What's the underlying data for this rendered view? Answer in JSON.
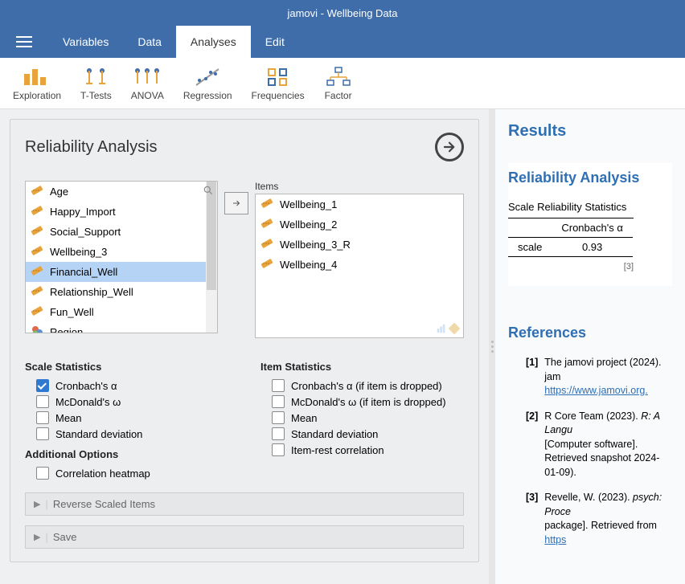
{
  "app": {
    "title": "jamovi - Wellbeing Data"
  },
  "menu": {
    "variables": "Variables",
    "data": "Data",
    "analyses": "Analyses",
    "edit": "Edit"
  },
  "ribbon": {
    "exploration": "Exploration",
    "ttests": "T-Tests",
    "anova": "ANOVA",
    "regression": "Regression",
    "frequencies": "Frequencies",
    "factor": "Factor"
  },
  "analysis": {
    "title": "Reliability Analysis",
    "source_vars": [
      "Age",
      "Happy_Import",
      "Social_Support",
      "Wellbeing_3",
      "Financial_Well",
      "Relationship_Well",
      "Fun_Well",
      "Region"
    ],
    "selected_source_idx": 4,
    "items_label": "Items",
    "target_vars": [
      "Wellbeing_1",
      "Wellbeing_2",
      "Wellbeing_3_R",
      "Wellbeing_4"
    ],
    "scale_stats_title": "Scale Statistics",
    "item_stats_title": "Item Statistics",
    "additional_title": "Additional Options",
    "scale_opts": {
      "cronbach": "Cronbach's α",
      "mcdonald": "McDonald's ω",
      "mean": "Mean",
      "sd": "Standard deviation"
    },
    "item_opts": {
      "cronbach": "Cronbach's α (if item is dropped)",
      "mcdonald": "McDonald's ω (if item is dropped)",
      "mean": "Mean",
      "sd": "Standard deviation",
      "irc": "Item-rest correlation"
    },
    "addl_opts": {
      "heatmap": "Correlation heatmap"
    },
    "collapse": {
      "reverse": "Reverse Scaled Items",
      "save": "Save"
    }
  },
  "results": {
    "title": "Results",
    "block_title": "Reliability Analysis",
    "table_caption": "Scale Reliability Statistics",
    "col_header": "Cronbach's α",
    "row_label": "scale",
    "value": "0.93",
    "footnote": "[3]",
    "references_title": "References",
    "refs": [
      {
        "num": "[1]",
        "text": "The jamovi project (2024). jam",
        "link": "https://www.jamovi.org",
        "link_text": "https://www.jamovi.org."
      },
      {
        "num": "[2]",
        "text_prefix": "R Core Team (2023). ",
        "text_ital": "R: A Langu",
        "text_after": "[Computer software]. Retrieved snapshot 2024-01-09)."
      },
      {
        "num": "[3]",
        "text_prefix": "Revelle, W. (2023). ",
        "text_ital": "psych: Proce",
        "text_after": "package]. Retrieved from ",
        "link_text": "https"
      }
    ]
  }
}
